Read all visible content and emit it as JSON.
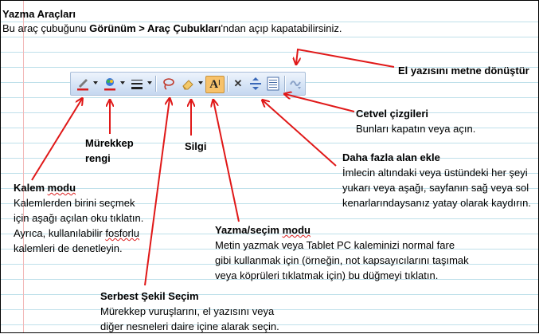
{
  "heading": {
    "title": "Yazma Araçları",
    "line_prefix": "Bu araç çubuğunu ",
    "line_bold": "Görünüm > Araç Çubukları",
    "line_suffix": "'ndan açıp kapatabilirsiniz."
  },
  "labels": {
    "convert": "El yazısını metne dönüştür",
    "ruled_title": "Cetvel çizgileri",
    "ruled_desc": "Bunları kapatın veya açın.",
    "ink_color_1": "Mürekkep",
    "ink_color_2": "rengi",
    "eraser": "Silgi",
    "space_title": "Daha fazla alan ekle",
    "space_desc_1": "İmlecin altındaki veya üstündeki her şeyi",
    "space_desc_2": "yukarı veya aşağı, sayfanın sağ veya sol",
    "space_desc_3": "kenarlarındaysanız yatay olarak kaydırın.",
    "pen_title_1": "Kalem ",
    "pen_title_2": "modu",
    "pen_desc_1": "Kalemlerden birini seçmek",
    "pen_desc_2": "için aşağı açılan oku tıklatın.",
    "pen_desc_3": "Ayrıca, kullanılabilir ",
    "pen_desc_3b": "fosforlu",
    "pen_desc_4": "kalemleri de denetleyin.",
    "type_title_1": "Yazma/seçim ",
    "type_title_2": "modu",
    "type_desc_1": "Metin yazmak veya Tablet PC kaleminizi normal fare",
    "type_desc_2": "gibi kullanmak için (örneğin, not kapsayıcılarını taşımak",
    "type_desc_3": "veya köprüleri tıklatmak için) bu düğmeyi tıklatın.",
    "lasso_title": "Serbest Şekil Seçim",
    "lasso_desc_1": "Mürekkep vuruşlarını, el yazısını veya",
    "lasso_desc_2": "diğer nesneleri daire içine alarak seçin."
  },
  "toolbar": {
    "text_mode_glyph": "A",
    "delete_glyph": "✕"
  },
  "colors": {
    "arrow": "#e01818",
    "pen_red": "#d81c1c",
    "text_mode_bg": "#f7c26b"
  }
}
